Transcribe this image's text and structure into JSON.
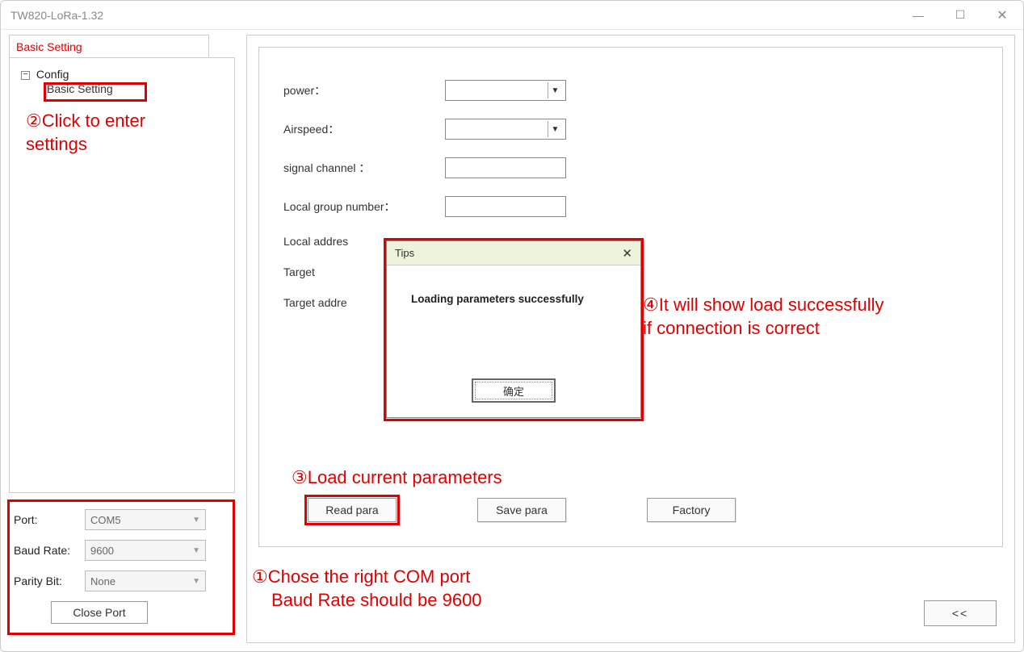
{
  "window": {
    "title": "TW820-LoRa-1.32"
  },
  "sidebar": {
    "tab_label": "Basic Setting",
    "tree_root": "Config",
    "tree_child": "Basic Setting"
  },
  "annotations": {
    "a2": "②Click to enter settings",
    "a3": "③Load current parameters",
    "a1_line1": "①Chose the right COM port",
    "a1_line2": "Baud Rate should be 9600",
    "a4_line1": "④It will show load successfully",
    "a4_line2": "if connection is correct"
  },
  "port": {
    "port_label": "Port:",
    "port_value": "COM5",
    "baud_label": "Baud Rate:",
    "baud_value": "9600",
    "parity_label": "Parity Bit:",
    "parity_value": "None",
    "close_btn": "Close Port"
  },
  "form": {
    "power": "power：",
    "airspeed": "Airspeed：",
    "signal_channel": "signal channel ：",
    "local_group": "Local group number：",
    "local_address": "Local addres",
    "target": "Target",
    "target_address": "Target addre"
  },
  "buttons": {
    "read": "Read para",
    "save": "Save para",
    "factory": "Factory",
    "collapse": "<<"
  },
  "modal": {
    "title": "Tips",
    "message": "Loading parameters successfully",
    "ok": "确定"
  }
}
